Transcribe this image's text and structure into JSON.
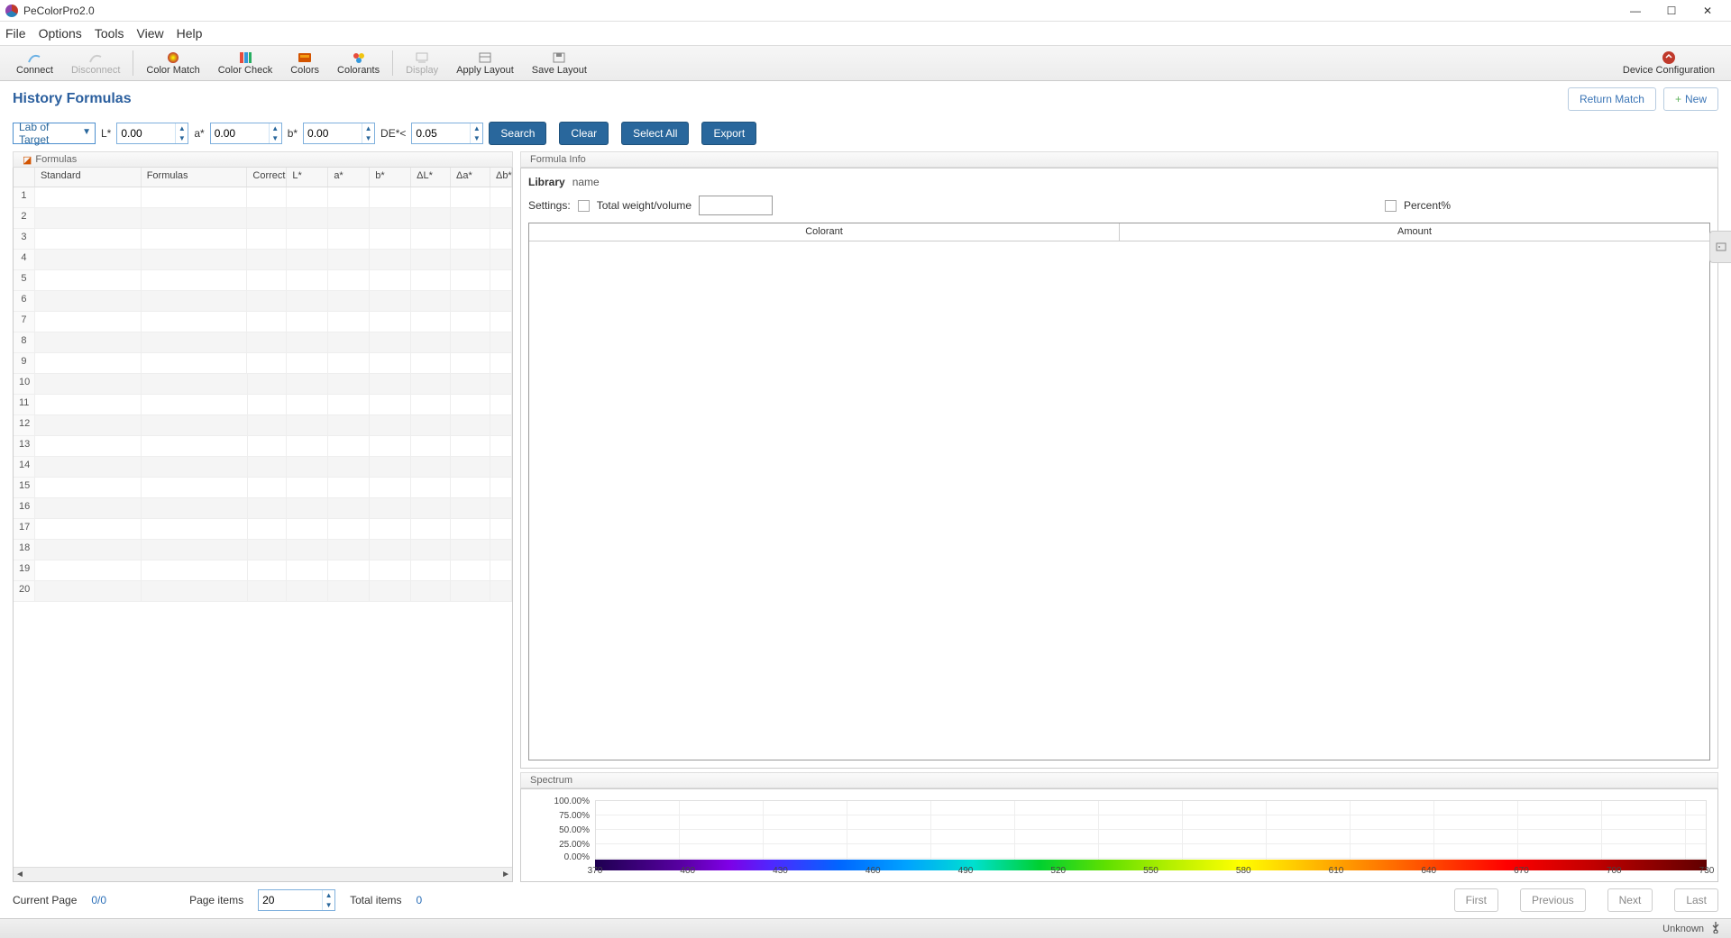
{
  "app": {
    "title": "PeColorPro2.0"
  },
  "win": {
    "min": "—",
    "max": "☐",
    "close": "✕"
  },
  "menu": [
    "File",
    "Options",
    "Tools",
    "View",
    "Help"
  ],
  "toolbar": {
    "connect": "Connect",
    "disconnect": "Disconnect",
    "color_match": "Color Match",
    "color_check": "Color Check",
    "colors": "Colors",
    "colorants": "Colorants",
    "display": "Display",
    "apply_layout": "Apply Layout",
    "save_layout": "Save Layout",
    "device_conf": "Device Configuration"
  },
  "page": {
    "title": "History Formulas",
    "return_match": "Return Match",
    "new": "New"
  },
  "search": {
    "target_select": "Lab of Target",
    "L_label": "L*",
    "L_val": "0.00",
    "a_label": "a*",
    "a_val": "0.00",
    "b_label": "b*",
    "b_val": "0.00",
    "de_label": "DE*<",
    "de_val": "0.05",
    "btn_search": "Search",
    "btn_clear": "Clear",
    "btn_selectall": "Select All",
    "btn_export": "Export"
  },
  "grid": {
    "pane_title": "Formulas",
    "cols": {
      "std": "Standard",
      "form": "Formulas",
      "corr": "Correct",
      "l": "L*",
      "a": "a*",
      "b": "b*",
      "dl": "ΔL*",
      "da": "Δa*",
      "db": "Δb*"
    },
    "rows": [
      1,
      2,
      3,
      4,
      5,
      6,
      7,
      8,
      9,
      10,
      11,
      12,
      13,
      14,
      15,
      16,
      17,
      18,
      19,
      20
    ]
  },
  "info": {
    "pane_title": "Formula Info",
    "library_lbl": "Library",
    "library_val": "name",
    "settings_lbl": "Settings:",
    "total_wv": "Total weight/volume",
    "percent": "Percent%",
    "col_colorant": "Colorant",
    "col_amount": "Amount"
  },
  "spectrum": {
    "pane_title": "Spectrum"
  },
  "chart_data": {
    "type": "line",
    "title": "Spectrum",
    "xlabel": "",
    "ylabel": "",
    "x": [
      370,
      400,
      430,
      460,
      490,
      520,
      550,
      580,
      610,
      640,
      670,
      700,
      730
    ],
    "ylim": [
      0,
      100
    ],
    "yticks": [
      "0.00%",
      "25.00%",
      "50.00%",
      "75.00%",
      "100.00%"
    ],
    "series": []
  },
  "pager": {
    "current_page_lbl": "Current Page",
    "current_page_val": "0/0",
    "page_items_lbl": "Page items",
    "page_items_val": "20",
    "total_items_lbl": "Total items",
    "total_items_val": "0",
    "first": "First",
    "prev": "Previous",
    "next": "Next",
    "last": "Last"
  },
  "status": {
    "text": "Unknown"
  }
}
